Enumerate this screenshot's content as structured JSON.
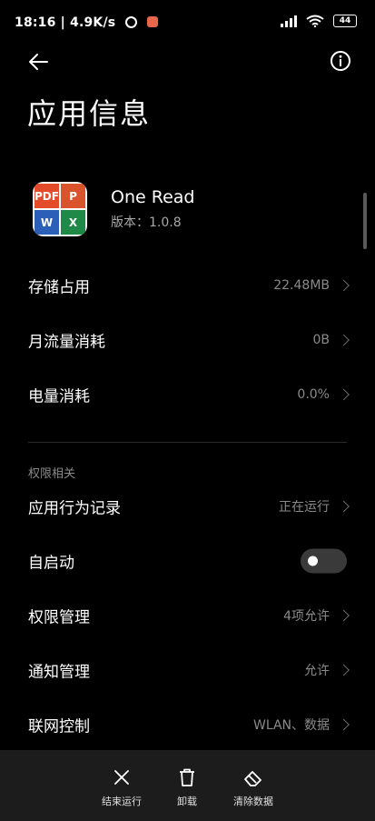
{
  "status_bar": {
    "time_speed": "18:16 | 4.9K/s",
    "battery": "44"
  },
  "page": {
    "title": "应用信息"
  },
  "app": {
    "name": "One Read",
    "version": "版本：1.0.8"
  },
  "rows": [
    {
      "label": "存储占用",
      "value": "22.48MB"
    },
    {
      "label": "月流量消耗",
      "value": "0B"
    },
    {
      "label": "电量消耗",
      "value": "0.0%"
    }
  ],
  "permissions": {
    "section_label": "权限相关",
    "rows": [
      {
        "label": "应用行为记录",
        "value": "正在运行"
      },
      {
        "label": "自启动",
        "toggle_on": false
      },
      {
        "label": "权限管理",
        "value": "4项允许"
      },
      {
        "label": "通知管理",
        "value": "允许"
      },
      {
        "label": "联网控制",
        "value": "WLAN、数据"
      }
    ]
  },
  "actions": [
    {
      "label": "结束运行",
      "icon": "close-icon"
    },
    {
      "label": "卸载",
      "icon": "trash-icon"
    },
    {
      "label": "清除数据",
      "icon": "eraser-icon"
    }
  ],
  "colors": {
    "background": "#000000",
    "secondary_text": "#8a8a8a",
    "bottom_bar": "#1c1c1c"
  }
}
